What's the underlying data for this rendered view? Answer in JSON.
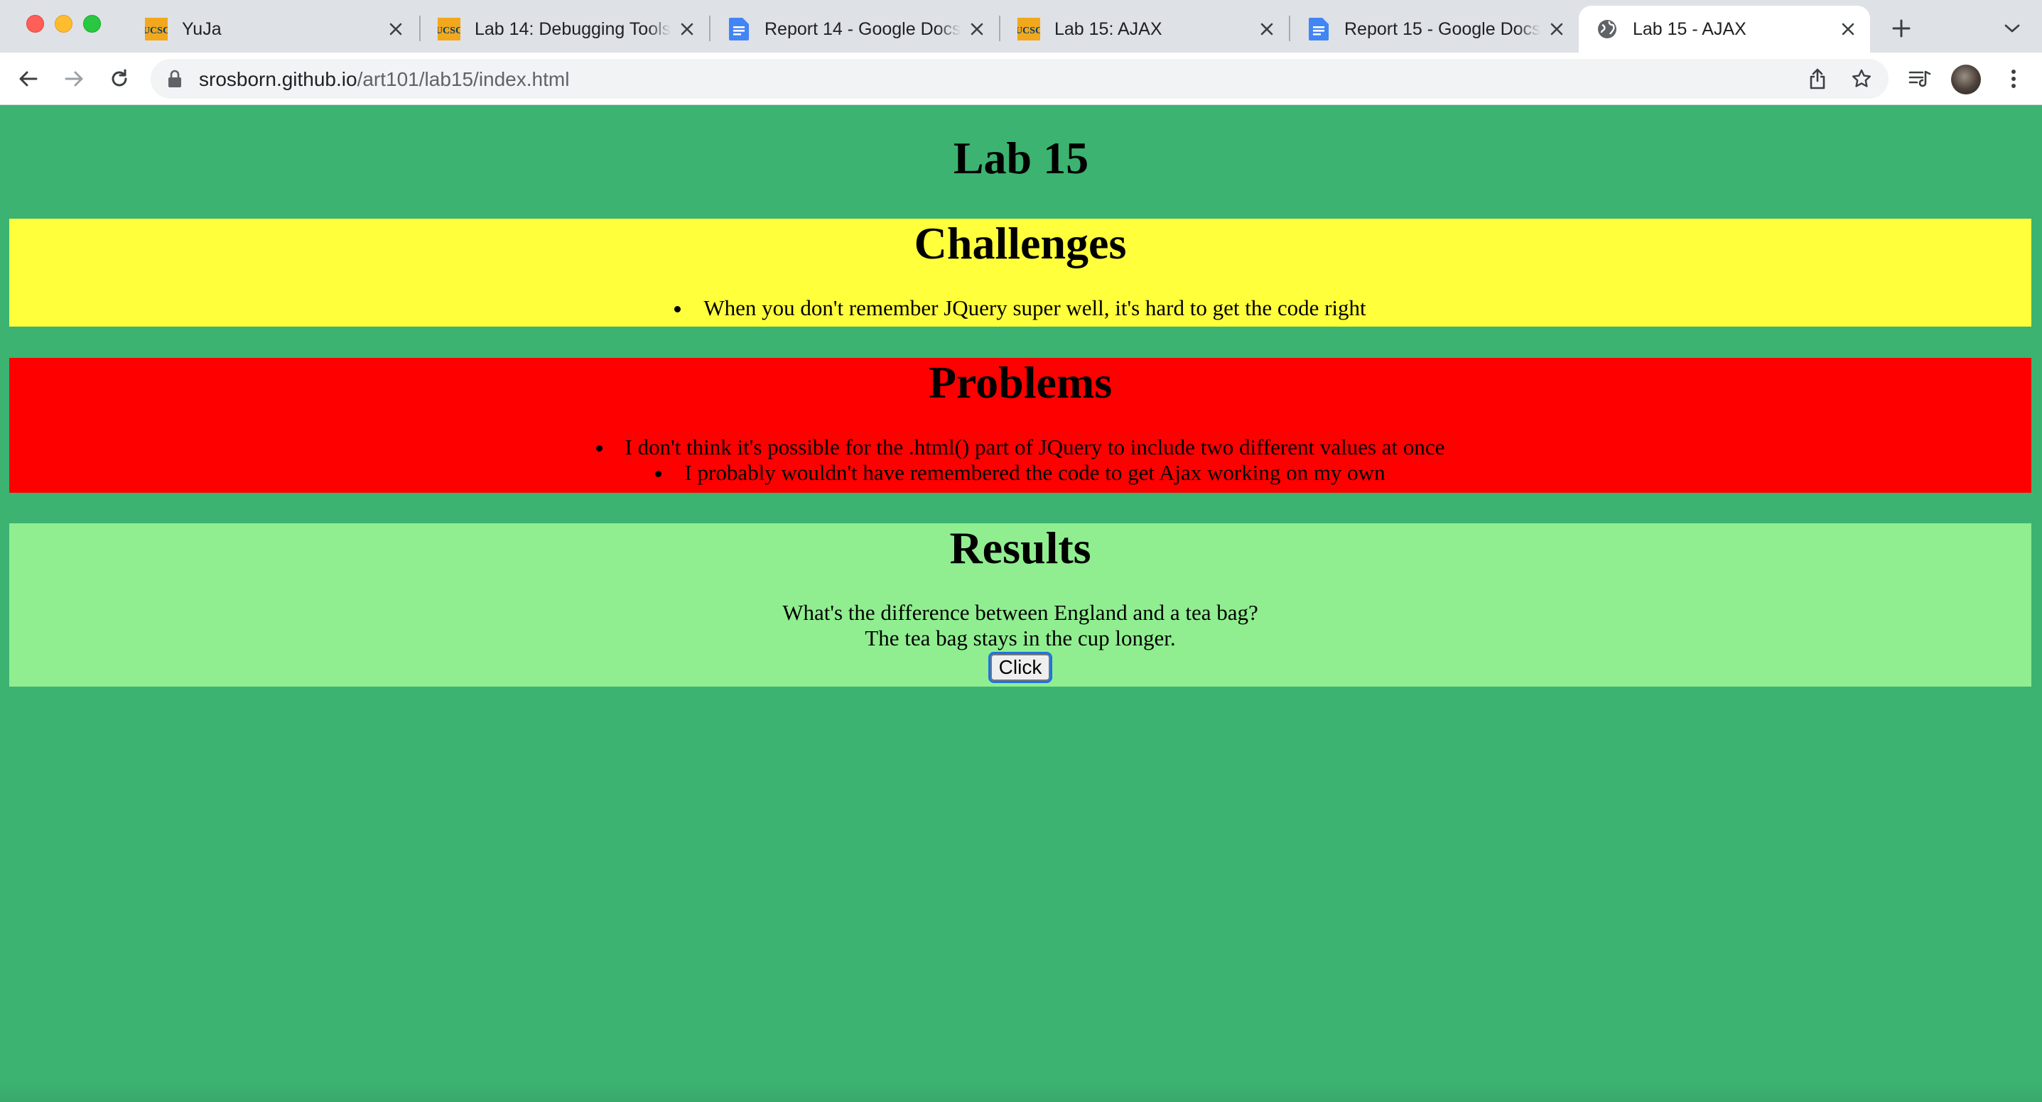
{
  "browser": {
    "tabs": [
      {
        "title": "YuJa",
        "favicon": "ucsc-icon",
        "active": false
      },
      {
        "title": "Lab 14: Debugging Tools",
        "favicon": "ucsc-icon",
        "active": false
      },
      {
        "title": "Report 14 - Google Docs",
        "favicon": "google-docs-icon",
        "active": false
      },
      {
        "title": "Lab 15: AJAX",
        "favicon": "ucsc-icon",
        "active": false
      },
      {
        "title": "Report 15 - Google Docs",
        "favicon": "google-docs-icon",
        "active": false
      },
      {
        "title": "Lab 15 - AJAX",
        "favicon": "globe-icon",
        "active": true
      }
    ],
    "address": {
      "host": "srosborn.github.io",
      "path": "/art101/lab15/index.html"
    }
  },
  "page": {
    "title": "Lab 15",
    "background_color": "#3cb371",
    "challenges": {
      "heading": "Challenges",
      "color": "#ffff3c",
      "items": [
        "When you don't remember JQuery super well, it's hard to get the code right"
      ]
    },
    "problems": {
      "heading": "Problems",
      "color": "#ff0000",
      "items": [
        "I don't think it's possible for the .html() part of JQuery to include two different values at once",
        "I probably wouldn't have remembered the code to get Ajax working on my own"
      ]
    },
    "results": {
      "heading": "Results",
      "color": "#90ee90",
      "question": "What's the difference between England and a tea bag?",
      "answer": "The tea bag stays in the cup longer.",
      "button_label": "Click"
    }
  }
}
